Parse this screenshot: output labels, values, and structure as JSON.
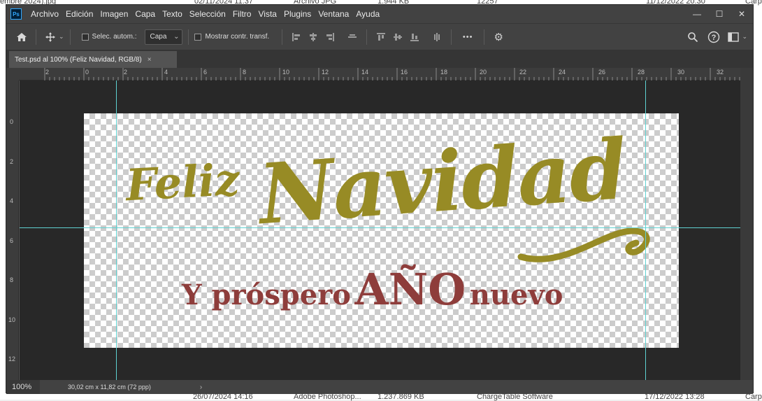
{
  "background_explorer": {
    "fragments": [
      "embre 2024).jpg",
      "02/11/2024 11:37",
      "Archivo JPG",
      "1.944 KB",
      "12257",
      "11/12/2022 20:30",
      "Carp",
      "26/07/2024 14:16",
      "Adobe Photoshop...",
      "1.237.869 KB",
      "ChargeTable Software",
      "17/12/2022 13:28",
      "Carp"
    ]
  },
  "app": {
    "logo": "Ps",
    "menu": [
      "Archivo",
      "Edición",
      "Imagen",
      "Capa",
      "Texto",
      "Selección",
      "Filtro",
      "Vista",
      "Plugins",
      "Ventana",
      "Ayuda"
    ],
    "window_controls": {
      "minimize": "—",
      "maximize": "☐",
      "close": "✕"
    }
  },
  "options_bar": {
    "auto_select_label": "Selec. autom.:",
    "auto_select_value": "Capa",
    "show_transform_label": "Mostrar contr. transf.",
    "more": "•••"
  },
  "document_tab": {
    "title": "Test.psd al 100% (Feliz  Navidad, RGB/8)",
    "close": "×"
  },
  "rulers": {
    "horizontal_labels": [
      "2",
      "0",
      "2",
      "4",
      "6",
      "8",
      "10",
      "12",
      "14",
      "16",
      "18",
      "20",
      "22",
      "24",
      "26",
      "28",
      "30",
      "32"
    ],
    "vertical_labels": [
      "0",
      "2",
      "4",
      "6",
      "8",
      "10",
      "12"
    ]
  },
  "artwork": {
    "line1_small": "Feliz",
    "line1_large": "Navidad",
    "line2_left": "Y próspero",
    "line2_center": "AÑO",
    "line2_right": "nuevo",
    "colors": {
      "gold": "#978b25",
      "maroon": "#8e3d3b",
      "guide": "#5fd2d2"
    }
  },
  "status_bar": {
    "zoom": "100%",
    "doc_size": "30,02 cm x 11,82 cm (72 ppp)",
    "arrow": "›"
  }
}
